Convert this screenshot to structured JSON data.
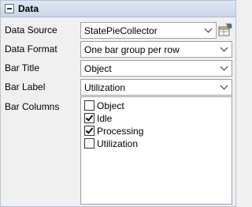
{
  "header": {
    "title": "Data"
  },
  "fields": {
    "data_source": {
      "label": "Data Source",
      "value": "StatePieCollector"
    },
    "data_format": {
      "label": "Data Format",
      "value": "One bar group per row"
    },
    "bar_title": {
      "label": "Bar Title",
      "value": "Object"
    },
    "bar_label": {
      "label": "Bar Label",
      "value": "Utilization"
    },
    "bar_columns": {
      "label": "Bar Columns",
      "items": [
        {
          "label": "Object",
          "checked": false
        },
        {
          "label": "Idle",
          "checked": true
        },
        {
          "label": "Processing",
          "checked": true
        },
        {
          "label": "Utilization",
          "checked": false
        }
      ]
    }
  },
  "icons": {
    "collapse": "minus-icon",
    "picker": "table-picker-icon",
    "dropdown": "chevron-down-icon"
  }
}
